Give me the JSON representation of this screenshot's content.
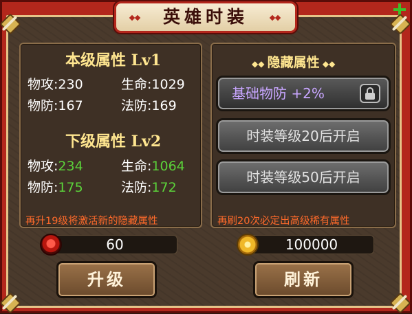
{
  "title": "英雄时装",
  "current_level": {
    "heading": "本级属性 Lv1",
    "stats": [
      {
        "label": "物攻:",
        "value": "230"
      },
      {
        "label": "生命:",
        "value": "1029"
      },
      {
        "label": "物防:",
        "value": "167"
      },
      {
        "label": "法防:",
        "value": "169"
      }
    ]
  },
  "next_level": {
    "heading": "下级属性 Lv2",
    "stats": [
      {
        "label": "物攻:",
        "value": "234"
      },
      {
        "label": "生命:",
        "value": "1064"
      },
      {
        "label": "物防:",
        "value": "175"
      },
      {
        "label": "法防:",
        "value": "172"
      }
    ]
  },
  "left_note": "再升19级将激活新的隐藏属性",
  "hidden": {
    "heading": "隐藏属性",
    "slots": [
      {
        "label": "基础物防 +2%",
        "locked": true
      },
      {
        "label": "时装等级20后开启"
      },
      {
        "label": "时装等级50后开启"
      }
    ],
    "note": "再刷20次必定出高级稀有属性"
  },
  "upgrade": {
    "cost_icon": "red-gem-icon",
    "cost": "60",
    "button": "升级"
  },
  "refresh": {
    "cost_icon": "gold-coin-icon",
    "cost": "100000",
    "button": "刷新"
  },
  "colors": {
    "frame": "#b3271c",
    "stat_next": "#5bd23a",
    "note": "#ff6a2a",
    "hidden_attr": "#c8a6ff"
  }
}
